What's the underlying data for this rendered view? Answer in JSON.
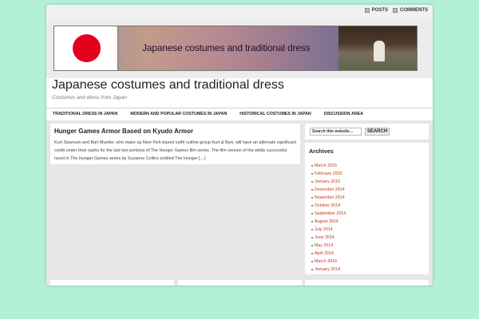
{
  "header": {
    "links": [
      "POSTS",
      "COMMENTS"
    ],
    "banner_text": "Japanese costumes and traditional dress",
    "site_title": "Japanese costumes and traditional dress",
    "site_description": "Costumes and dress from Japan"
  },
  "nav": {
    "items": [
      "TRADITIONAL DRESS IN JAPAN",
      "MODERN AND POPULAR COSTUMES IN JAPAN",
      "HISTORICAL COSTUMES IN JAPAN",
      "DISCUSSION AREA"
    ]
  },
  "post": {
    "title": "Hunger Games Armor Based on Kyudo Armor",
    "excerpt": "Kurt Swanson and Bart Mueller, who make up New York-based outfit outline group Kurt & Bart, will have an alternate significant credit under their sashs for the last two portions of The Hunger Games film series. The film version of the wildly successful novel in The Hunger Games series by Suzanne Collins entitled The Hunger […]"
  },
  "search": {
    "placeholder": "Search this website…",
    "button_label": "SEARCH"
  },
  "archives": {
    "title": "Archives",
    "items": [
      "March 2015",
      "February 2015",
      "January 2015",
      "December 2014",
      "November 2014",
      "October 2014",
      "September 2014",
      "August 2014",
      "July 2014",
      "June 2014",
      "May 2014",
      "April 2014",
      "March 2014",
      "January 2014"
    ]
  },
  "colors": {
    "background": "#b3f0d8",
    "link": "#c0351a",
    "flag_red": "#e3001b"
  }
}
